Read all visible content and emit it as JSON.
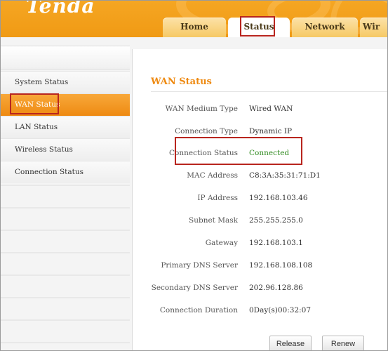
{
  "brand": {
    "logo_text": "Tenda"
  },
  "tabs": [
    {
      "label": "Home"
    },
    {
      "label": "Status"
    },
    {
      "label": "Network"
    },
    {
      "label": "Wir"
    }
  ],
  "sidebar": {
    "items": [
      {
        "label": "System Status"
      },
      {
        "label": "WAN Status"
      },
      {
        "label": "LAN Status"
      },
      {
        "label": "Wireless Status"
      },
      {
        "label": "Connection Status"
      }
    ]
  },
  "main": {
    "title": "WAN Status",
    "rows": [
      {
        "label": "WAN Medium Type",
        "value": "Wired WAN"
      },
      {
        "label": "Connection Type",
        "value": "Dynamic IP"
      },
      {
        "label": "Connection Status",
        "value": "Connected"
      },
      {
        "label": "MAC Address",
        "value": "C8:3A:35:31:71:D1"
      },
      {
        "label": "IP Address",
        "value": "192.168.103.46"
      },
      {
        "label": "Subnet Mask",
        "value": "255.255.255.0"
      },
      {
        "label": "Gateway",
        "value": "192.168.103.1"
      },
      {
        "label": "Primary DNS Server",
        "value": "192.168.108.108"
      },
      {
        "label": "Secondary DNS Server",
        "value": "202.96.128.86"
      },
      {
        "label": "Connection Duration",
        "value": "0Day(s)00:32:07"
      }
    ],
    "buttons": {
      "release": "Release",
      "renew": "Renew"
    }
  },
  "colors": {
    "accent": "#f09a14",
    "connected": "#2f8a1e",
    "highlight": "#b8251e"
  }
}
